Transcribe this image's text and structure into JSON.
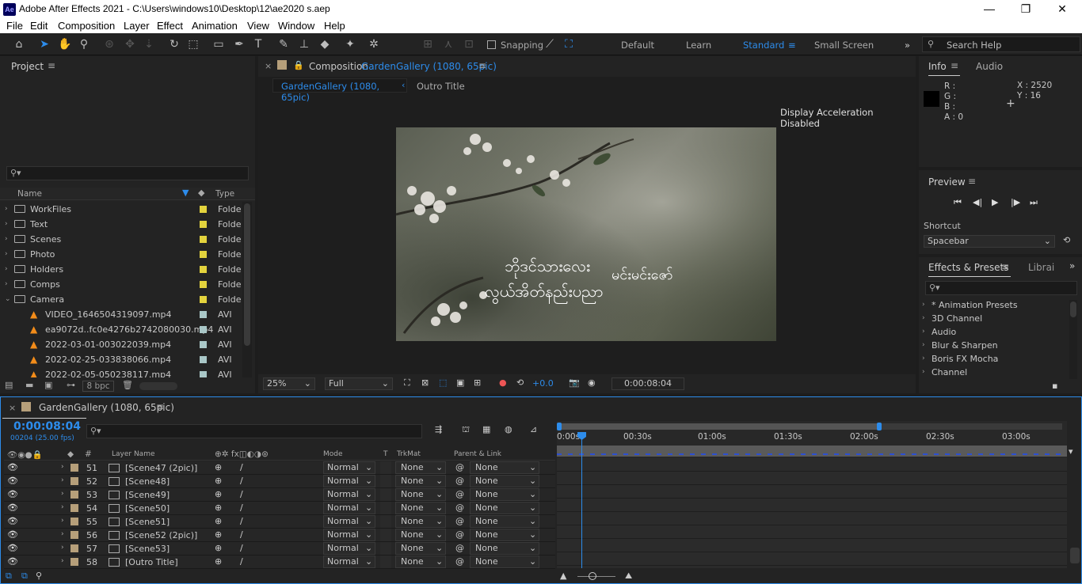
{
  "titlebar": {
    "logo": "Ae",
    "title": "Adobe After Effects 2021 - C:\\Users\\windows10\\Desktop\\12\\ae2020 s.aep",
    "minimize": "—",
    "maximize": "❐",
    "close": "✕"
  },
  "menu": [
    "File",
    "Edit",
    "Composition",
    "Layer",
    "Effect",
    "Animation",
    "View",
    "Window",
    "Help"
  ],
  "toolbar": {
    "snapping": "Snapping",
    "workspaces": [
      "Default",
      "Learn",
      "Standard",
      "Small Screen"
    ],
    "active_workspace": "Standard",
    "search_help": "Search Help"
  },
  "project": {
    "title": "Project",
    "col_name": "Name",
    "col_type": "Type",
    "search_placeholder": "",
    "items": [
      {
        "name": "WorkFiles",
        "type": "Folde",
        "kind": "folder",
        "label": "yellow"
      },
      {
        "name": "Text",
        "type": "Folde",
        "kind": "folder",
        "label": "yellow"
      },
      {
        "name": "Scenes",
        "type": "Folde",
        "kind": "folder",
        "label": "yellow"
      },
      {
        "name": "Photo",
        "type": "Folde",
        "kind": "folder",
        "label": "yellow"
      },
      {
        "name": "Holders",
        "type": "Folde",
        "kind": "folder",
        "label": "yellow"
      },
      {
        "name": "Comps",
        "type": "Folde",
        "kind": "folder",
        "label": "yellow"
      },
      {
        "name": "Camera",
        "type": "Folde",
        "kind": "folder-open",
        "label": "yellow"
      },
      {
        "name": "VIDEO_1646504319097.mp4",
        "type": "AVI",
        "kind": "video",
        "label": "lgray"
      },
      {
        "name": "ea9072d..fc0e4276b2742080030.mp4",
        "type": "AVI",
        "kind": "video",
        "label": "lgray"
      },
      {
        "name": "2022-03-01-003022039.mp4",
        "type": "AVI",
        "kind": "video",
        "label": "lgray"
      },
      {
        "name": "2022-02-25-033838066.mp4",
        "type": "AVI",
        "kind": "video",
        "label": "lgray"
      },
      {
        "name": "2022-02-05-050238117.mp4",
        "type": "AVI",
        "kind": "video",
        "label": "lgray"
      }
    ],
    "bpc": "8 bpc"
  },
  "composition": {
    "panel_label": "Composition",
    "comp_name": "GardenGallery (1080, 65pic)",
    "tabs": [
      "GardenGallery (1080, 65pic)",
      "Outro Title"
    ],
    "notice": "Display Acceleration Disabled",
    "caption_line1": "ဘိုဒင်သားလေး",
    "caption_line1b": "မင်းမင်းဇော်",
    "caption_line2": "လွယ်အိတ်နည်းပညာ",
    "zoom": "25%",
    "resolution": "Full",
    "exposure": "+0.0",
    "timecode": "0:00:08:04"
  },
  "info": {
    "tab_info": "Info",
    "tab_audio": "Audio",
    "r": "R :",
    "g": "G :",
    "b": "B :",
    "a": "A :  0",
    "x": "X : 2520",
    "y": "Y : 16"
  },
  "preview": {
    "title": "Preview",
    "shortcut_label": "Shortcut",
    "shortcut_value": "Spacebar"
  },
  "effects": {
    "tab_effects": "Effects & Presets",
    "tab_libs": "Librai",
    "items": [
      "* Animation Presets",
      "3D Channel",
      "Audio",
      "Blur & Sharpen",
      "Boris FX Mocha",
      "Channel"
    ]
  },
  "timeline": {
    "comp_name": "GardenGallery (1080, 65pic)",
    "timecode": "0:00:08:04",
    "frames": "00204 (25.00 fps)",
    "col_layer": "Layer Name",
    "col_mode": "Mode",
    "col_t": "T",
    "col_trkmat": "TrkMat",
    "col_parent": "Parent & Link",
    "ruler": [
      "0:00s",
      "00:30s",
      "01:00s",
      "01:30s",
      "02:00s",
      "02:30s",
      "03:00s"
    ],
    "layers": [
      {
        "num": "51",
        "name": "[Scene47 (2pic)]",
        "mode": "Normal",
        "trkmat": "None",
        "parent": "None"
      },
      {
        "num": "52",
        "name": "[Scene48]",
        "mode": "Normal",
        "trkmat": "None",
        "parent": "None"
      },
      {
        "num": "53",
        "name": "[Scene49]",
        "mode": "Normal",
        "trkmat": "None",
        "parent": "None"
      },
      {
        "num": "54",
        "name": "[Scene50]",
        "mode": "Normal",
        "trkmat": "None",
        "parent": "None"
      },
      {
        "num": "55",
        "name": "[Scene51]",
        "mode": "Normal",
        "trkmat": "None",
        "parent": "None"
      },
      {
        "num": "56",
        "name": "[Scene52 (2pic)]",
        "mode": "Normal",
        "trkmat": "None",
        "parent": "None"
      },
      {
        "num": "57",
        "name": "[Scene53]",
        "mode": "Normal",
        "trkmat": "None",
        "parent": "None"
      },
      {
        "num": "58",
        "name": "[Outro Title]",
        "mode": "Normal",
        "trkmat": "None",
        "parent": "None"
      }
    ]
  },
  "colors": {
    "accent": "#2d8ceb",
    "panel": "#232323",
    "bg": "#1d1d1d"
  }
}
